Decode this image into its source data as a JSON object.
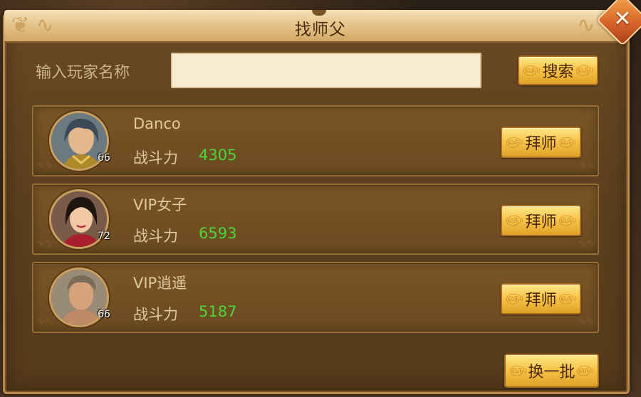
{
  "dialog": {
    "title": "找师父",
    "close_icon": "close-icon"
  },
  "search": {
    "label": "输入玩家名称",
    "value": "",
    "placeholder": "",
    "button_label": "搜索"
  },
  "players": [
    {
      "name": "Danco",
      "level": "66",
      "power_label": "战斗力",
      "power": "4305",
      "button_label": "拜师",
      "avatar_icon": "male-warrior-avatar"
    },
    {
      "name": "VIP女子",
      "level": "72",
      "power_label": "战斗力",
      "power": "6593",
      "button_label": "拜师",
      "avatar_icon": "female-avatar"
    },
    {
      "name": "VIP逍遥",
      "level": "66",
      "power_label": "战斗力",
      "power": "5187",
      "button_label": "拜师",
      "avatar_icon": "male-brawler-avatar"
    }
  ],
  "refresh_button_label": "换一批",
  "colors": {
    "power_value": "#4bd63a",
    "gold_button": "#f7c64a",
    "panel": "#6b4a24"
  }
}
